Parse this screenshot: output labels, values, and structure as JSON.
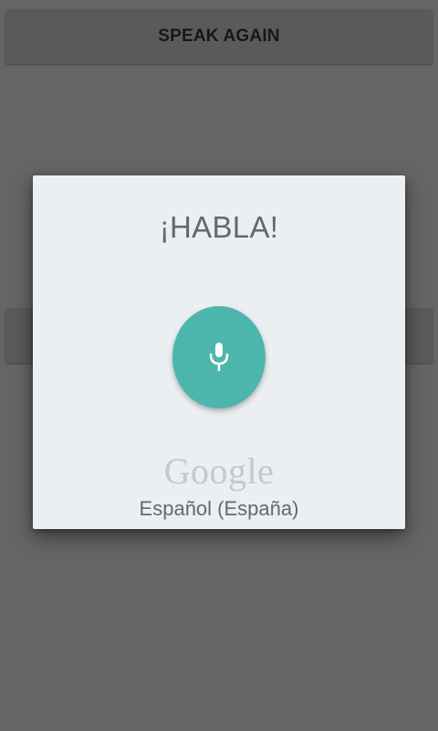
{
  "background_button": {
    "label": "SPEAK AGAIN"
  },
  "dialog": {
    "prompt": "¡HABLA!",
    "mic_icon": "microphone-icon",
    "logo_text": "Google",
    "language": "Español (España)"
  },
  "colors": {
    "overlay_bg": "#656565",
    "dialog_bg": "#eceff1",
    "mic_button": "#4db6ac",
    "text": "#5f6b70",
    "logo": "#c5c9cb"
  }
}
